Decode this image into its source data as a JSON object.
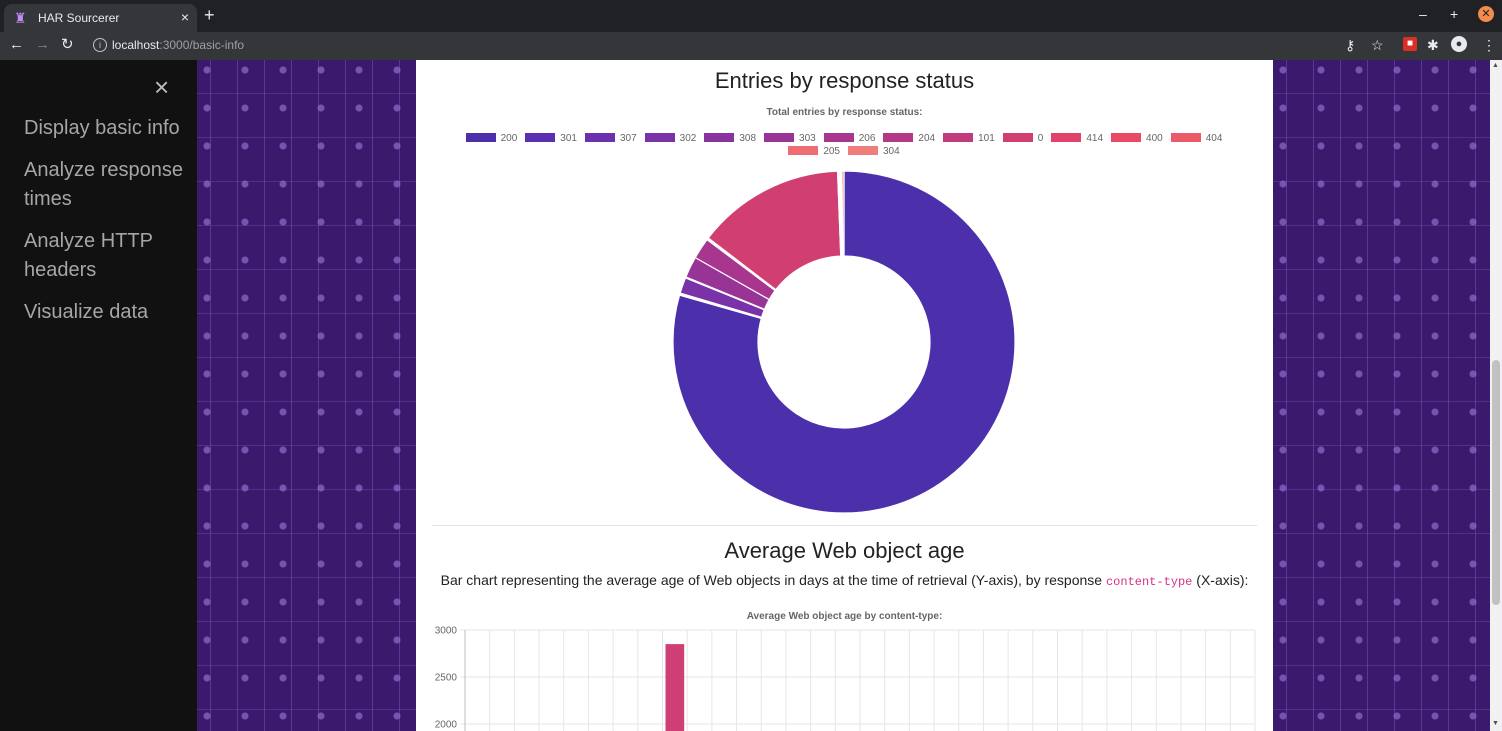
{
  "browser": {
    "tab_title": "HAR Sourcerer",
    "url_host": "localhost",
    "url_path": ":3000/basic-info"
  },
  "sidenav": {
    "close_label": "×",
    "items": [
      "Display basic info",
      "Analyze response times",
      "Analyze HTTP headers",
      "Visualize data"
    ]
  },
  "section_status": {
    "heading": "Entries by response status",
    "chart_title": "Total entries by response status:"
  },
  "section_age": {
    "heading": "Average Web object age",
    "desc_before": "Bar chart representing the average age of Web objects in days at the time of retrieval (Y-axis), by response ",
    "desc_code": "content-type",
    "desc_after": " (X-axis):",
    "chart_title": "Average Web object age by content-type:"
  },
  "chart_data": [
    {
      "type": "pie",
      "variant": "doughnut",
      "title": "Total entries by response status:",
      "legend_position": "top",
      "labels": [
        "200",
        "301",
        "307",
        "302",
        "308",
        "303",
        "206",
        "204",
        "101",
        "0",
        "414",
        "400",
        "404",
        "205",
        "304"
      ],
      "values": [
        79.5,
        0.1,
        0.1,
        1.5,
        0.1,
        2.0,
        2.0,
        0.1,
        0.1,
        14.0,
        0.1,
        0.1,
        0.1,
        0.1,
        0.2
      ],
      "colors": [
        "#4c2fab",
        "#5a2fb0",
        "#6b30ae",
        "#7a32a8",
        "#8933a0",
        "#993497",
        "#a8368e",
        "#b53886",
        "#c33a7c",
        "#d13e72",
        "#df436a",
        "#e84a66",
        "#ec5a69",
        "#ef6c72",
        "#ef7e7a"
      ]
    },
    {
      "type": "bar",
      "title": "Average Web object age by content-type:",
      "ylim": [
        0,
        3000
      ],
      "yticks": [
        3000,
        2500,
        2000
      ],
      "category_count": 32,
      "bars": [
        {
          "category_index": 8,
          "value": 2850,
          "color": "#cf3f75"
        }
      ],
      "grid": true
    }
  ]
}
